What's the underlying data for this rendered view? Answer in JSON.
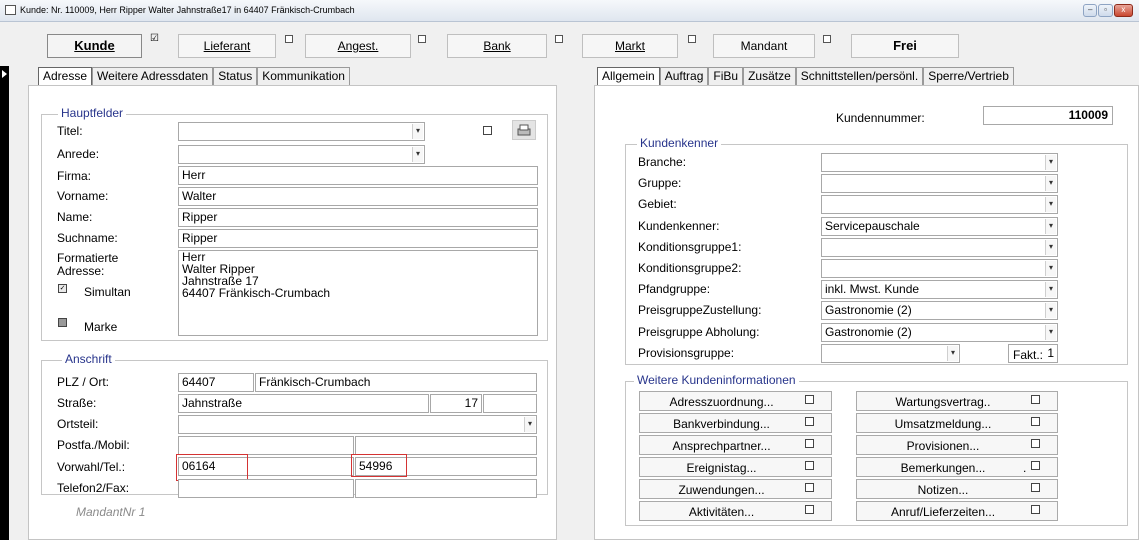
{
  "window": {
    "title": "Kunde: Nr. 110009, Herr Ripper Walter Jahnstraße17 in 64407 Fränkisch-Crumbach",
    "buttons": [
      "–",
      "▫",
      "x"
    ]
  },
  "toolbar": {
    "kunde": "Kunde",
    "lieferant": "Lieferant",
    "angest": "Angest.",
    "bank": "Bank",
    "markt": "Markt",
    "mandant": "Mandant",
    "frei": "Frei",
    "kunde_check": "☑"
  },
  "left_tabs": [
    "Adresse",
    "Weitere Adressdaten",
    "Status",
    "Kommunikation"
  ],
  "right_tabs": [
    "Allgemein",
    "Auftrag",
    "FiBu",
    "Zusätze",
    "Schnittstellen/persönl.",
    "Sperre/Vertrieb"
  ],
  "hauptfelder": {
    "label": "Hauptfelder",
    "titel_label": "Titel:",
    "titel_value": "",
    "anrede_label": "Anrede:",
    "anrede_value": "",
    "firma_label": "Firma:",
    "firma_value": "Herr",
    "vorname_label": "Vorname:",
    "vorname_value": "Walter",
    "name_label": "Name:",
    "name_value": "Ripper",
    "suchname_label": "Suchname:",
    "suchname_value": "Ripper",
    "formatierte_label_1": "Formatierte",
    "formatierte_label_2": "Adresse:",
    "address_lines": [
      "Herr",
      "Walter Ripper",
      "Jahnstraße 17",
      "64407 Fränkisch-Crumbach"
    ],
    "simultan_label": "Simultan",
    "marke_label": "Marke"
  },
  "anschrift": {
    "label": "Anschrift",
    "plz_label": "PLZ / Ort:",
    "plz_value": "64407",
    "ort_value": "Fränkisch-Crumbach",
    "strasse_label": "Straße:",
    "strasse_value": "Jahnstraße",
    "hausnr_value": "17",
    "ortsteil_label": "Ortsteil:",
    "postfa_label": "Postfa./Mobil:",
    "vorwahl_label": "Vorwahl/Tel.:",
    "vorwahl_value": "06164",
    "tel_value": "54996",
    "telefon2_label": "Telefon2/Fax:",
    "mandant_nr": "MandantNr 1"
  },
  "kunden": {
    "kundennummer_label": "Kundennummer:",
    "kundennummer_value": "110009",
    "kenner_label": "Kundenkenner",
    "rows": [
      {
        "label": "Branche:",
        "value": ""
      },
      {
        "label": "Gruppe:",
        "value": ""
      },
      {
        "label": "Gebiet:",
        "value": ""
      },
      {
        "label": "Kundenkenner:",
        "value": "Servicepauschale"
      },
      {
        "label": "Konditionsgruppe1:",
        "value": ""
      },
      {
        "label": "Konditionsgruppe2:",
        "value": ""
      },
      {
        "label": "Pfandgruppe:",
        "value": "inkl. Mwst. Kunde"
      },
      {
        "label": "PreisgruppeZustellung:",
        "value": "Gastronomie (2)"
      },
      {
        "label": "Preisgruppe Abholung:",
        "value": "Gastronomie (2)"
      },
      {
        "label": "Provisionsgruppe:",
        "value": ""
      }
    ],
    "fakt_label": "Fakt.:",
    "fakt_value": "1"
  },
  "weitere": {
    "label": "Weitere Kundeninformationen",
    "left": [
      "Adresszuordnung...",
      "Bankverbindung...",
      "Ansprechpartner...",
      "Ereignistag...",
      "Zuwendungen...",
      "Aktivitäten..."
    ],
    "right": [
      "Wartungsvertrag..",
      "Umsatzmeldung...",
      "Provisionen...",
      "Bemerkungen...",
      "Notizen...",
      "Anruf/Lieferzeiten..."
    ],
    "dot": "."
  }
}
